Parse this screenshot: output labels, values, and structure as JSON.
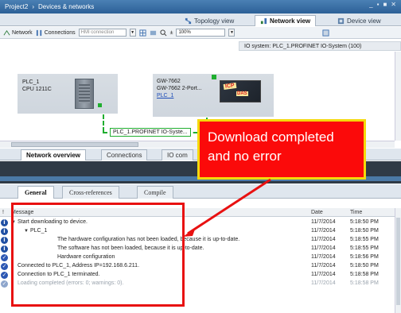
{
  "window": {
    "project": "Project2",
    "separator": "›",
    "section": "Devices & networks",
    "controls": [
      "_",
      "▪",
      "■",
      "✕"
    ]
  },
  "view_tabs": [
    "Topology view",
    "Network view",
    "Device view"
  ],
  "toolbar": {
    "network": "Network",
    "connections": "Connections",
    "hmi_connection": "HMI connection",
    "zoom": "100%"
  },
  "io_system": "IO system: PLC_1.PROFINET IO-System (100)",
  "devices": {
    "plc": {
      "name": "PLC_1",
      "cpu": "CPU 1211C"
    },
    "gateway": {
      "name": "GW-7662",
      "model": "GW-7662 2-Port...",
      "link": "PLC_1",
      "badge": "ICP",
      "badge2": "DAS"
    }
  },
  "network_label": "PLC_1.PROFINET IO-Syste...",
  "lower_tabs": [
    "Network overview",
    "Connections",
    "IO com"
  ],
  "info_tabs": [
    "General",
    "Cross-references",
    "Compile"
  ],
  "messages": {
    "headers": {
      "bang": "!",
      "message": "Message",
      "date": "Date",
      "time": "Time"
    },
    "rows": [
      {
        "text": "Start downloading to device.",
        "date": "11/7/2014",
        "time": "5:18:50 PM"
      },
      {
        "text": "PLC_1",
        "date": "11/7/2014",
        "time": "5:18:50 PM"
      },
      {
        "text": "The hardware configuration has not been loaded, because it is up-to-date.",
        "date": "11/7/2014",
        "time": "5:18:55 PM"
      },
      {
        "text": "The software has not been loaded, because it is up-to-date.",
        "date": "11/7/2014",
        "time": "5:18:55 PM"
      },
      {
        "text": "Hardware configuration",
        "date": "11/7/2014",
        "time": "5:18:56 PM"
      },
      {
        "text": "Connected to PLC_1, Address IP=192.168.6.211.",
        "date": "11/7/2014",
        "time": "5:18:50 PM"
      },
      {
        "text": "Connection to PLC_1 terminated.",
        "date": "11/7/2014",
        "time": "5:18:58 PM"
      },
      {
        "text": "Loading completed (errors: 0; warnings: 0).",
        "date": "11/7/2014",
        "time": "5:18:58 PM"
      }
    ]
  },
  "annotation": {
    "line1": "Download completed",
    "line2": "and no error"
  },
  "colors": {
    "callout_bg": "#fb0a0a",
    "callout_border": "#f5d90b",
    "highlight": "#e81111",
    "link_green": "#1fae2f"
  }
}
